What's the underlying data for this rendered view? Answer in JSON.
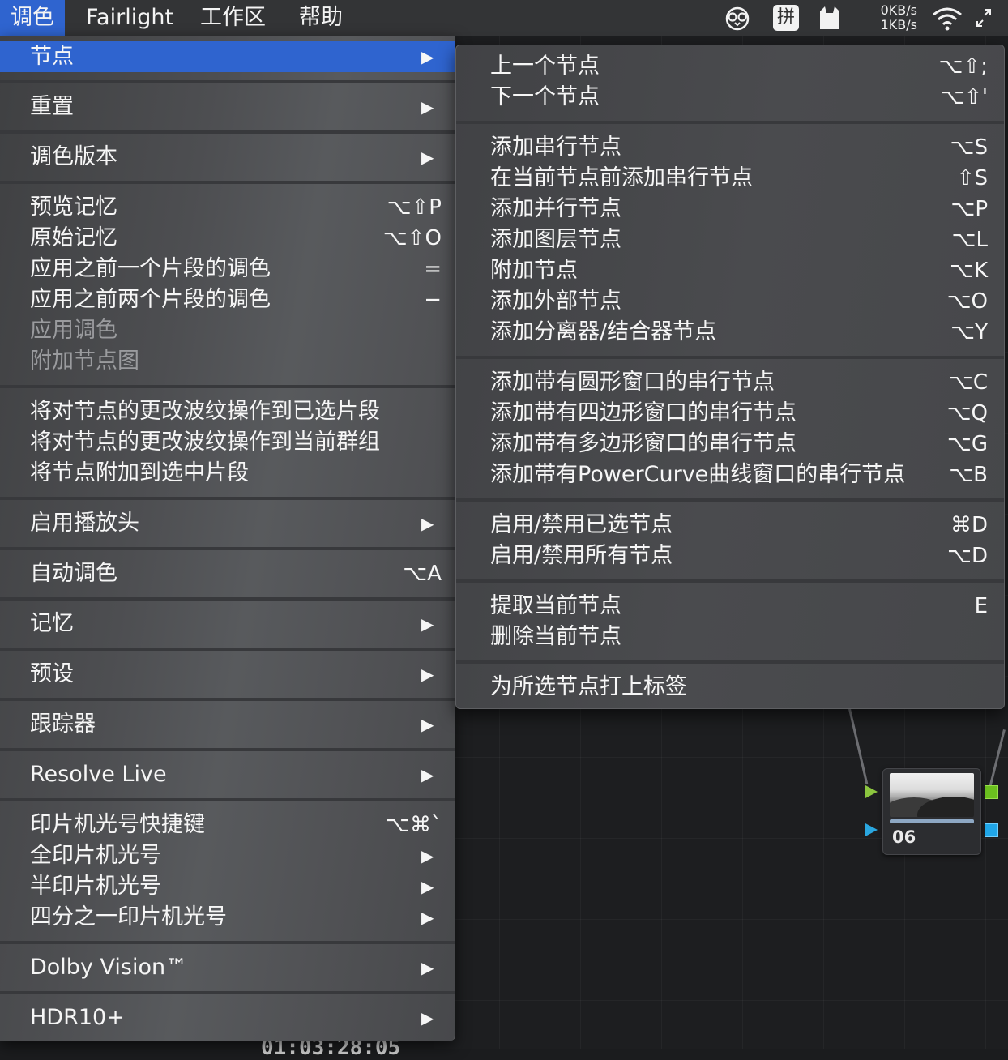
{
  "menubar": {
    "items": [
      "调色",
      "Fairlight",
      "工作区",
      "帮助"
    ],
    "net_up": "0KB/s",
    "net_down": "1KB/s",
    "ime_label": "拼"
  },
  "main_menu": {
    "items": [
      {
        "label": "节点",
        "shortcut": "",
        "arrow": "▶"
      },
      {
        "label": "重置",
        "shortcut": "",
        "arrow": "▶"
      },
      {
        "label": "调色版本",
        "shortcut": "",
        "arrow": "▶"
      },
      {
        "label": "预览记忆",
        "shortcut": "⌥⇧P",
        "arrow": ""
      },
      {
        "label": "原始记忆",
        "shortcut": "⌥⇧O",
        "arrow": ""
      },
      {
        "label": "应用之前一个片段的调色",
        "shortcut": "=",
        "arrow": ""
      },
      {
        "label": "应用之前两个片段的调色",
        "shortcut": "−",
        "arrow": ""
      },
      {
        "label": "应用调色",
        "shortcut": "",
        "arrow": ""
      },
      {
        "label": "附加节点图",
        "shortcut": "",
        "arrow": ""
      },
      {
        "label": "将对节点的更改波纹操作到已选片段",
        "shortcut": "",
        "arrow": ""
      },
      {
        "label": "将对节点的更改波纹操作到当前群组",
        "shortcut": "",
        "arrow": ""
      },
      {
        "label": "将节点附加到选中片段",
        "shortcut": "",
        "arrow": ""
      },
      {
        "label": "启用播放头",
        "shortcut": "",
        "arrow": "▶"
      },
      {
        "label": "自动调色",
        "shortcut": "⌥A",
        "arrow": ""
      },
      {
        "label": "记忆",
        "shortcut": "",
        "arrow": "▶"
      },
      {
        "label": "预设",
        "shortcut": "",
        "arrow": "▶"
      },
      {
        "label": "跟踪器",
        "shortcut": "",
        "arrow": "▶"
      },
      {
        "label": "Resolve Live",
        "shortcut": "",
        "arrow": "▶"
      },
      {
        "label": "印片机光号快捷键",
        "shortcut": "⌥⌘`",
        "arrow": ""
      },
      {
        "label": "全印片机光号",
        "shortcut": "",
        "arrow": "▶"
      },
      {
        "label": "半印片机光号",
        "shortcut": "",
        "arrow": "▶"
      },
      {
        "label": "四分之一印片机光号",
        "shortcut": "",
        "arrow": "▶"
      },
      {
        "label": "Dolby Vision™",
        "shortcut": "",
        "arrow": "▶"
      },
      {
        "label": "HDR10+",
        "shortcut": "",
        "arrow": "▶"
      }
    ]
  },
  "sub_menu": {
    "items": [
      {
        "label": "上一个节点",
        "shortcut": "⌥⇧;"
      },
      {
        "label": "下一个节点",
        "shortcut": "⌥⇧'"
      },
      {
        "label": "添加串行节点",
        "shortcut": "⌥S"
      },
      {
        "label": "在当前节点前添加串行节点",
        "shortcut": "⇧S"
      },
      {
        "label": "添加并行节点",
        "shortcut": "⌥P"
      },
      {
        "label": "添加图层节点",
        "shortcut": "⌥L"
      },
      {
        "label": "附加节点",
        "shortcut": "⌥K"
      },
      {
        "label": "添加外部节点",
        "shortcut": "⌥O"
      },
      {
        "label": "添加分离器/结合器节点",
        "shortcut": "⌥Y"
      },
      {
        "label": "添加带有圆形窗口的串行节点",
        "shortcut": "⌥C"
      },
      {
        "label": "添加带有四边形窗口的串行节点",
        "shortcut": "⌥Q"
      },
      {
        "label": "添加带有多边形窗口的串行节点",
        "shortcut": "⌥G"
      },
      {
        "label": "添加带有PowerCurve曲线窗口的串行节点",
        "shortcut": "⌥B"
      },
      {
        "label": "启用/禁用已选节点",
        "shortcut": "⌘D"
      },
      {
        "label": "启用/禁用所有节点",
        "shortcut": "⌥D"
      },
      {
        "label": "提取当前节点",
        "shortcut": "E"
      },
      {
        "label": "删除当前节点",
        "shortcut": ""
      },
      {
        "label": "为所选节点打上标签",
        "shortcut": ""
      }
    ]
  },
  "node": {
    "label": "06"
  },
  "timecode": "01:03:28:05"
}
